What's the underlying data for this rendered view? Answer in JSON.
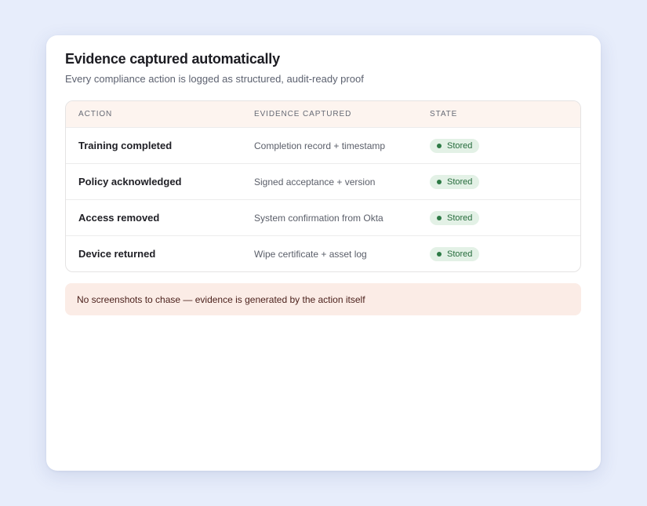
{
  "card": {
    "title": "Evidence captured automatically",
    "subtitle": "Every compliance action is logged as structured, audit-ready proof"
  },
  "table": {
    "headers": {
      "action": "ACTION",
      "evidence": "EVIDENCE CAPTURED",
      "state": "STATE"
    },
    "rows": [
      {
        "action": "Training completed",
        "evidence": "Completion record + timestamp",
        "state": "Stored"
      },
      {
        "action": "Policy acknowledged",
        "evidence": "Signed acceptance + version",
        "state": "Stored"
      },
      {
        "action": "Access removed",
        "evidence": "System confirmation from Okta",
        "state": "Stored"
      },
      {
        "action": "Device returned",
        "evidence": "Wipe certificate + asset log",
        "state": "Stored"
      }
    ]
  },
  "note": {
    "text": "No screenshots to chase — evidence is generated by the action itself"
  },
  "colors": {
    "page_background": "#e7edfb",
    "header_background": "#fdf4ef",
    "note_background": "#fbece6",
    "badge_background": "#e3f1e6",
    "badge_text": "#256b3b"
  },
  "icons": {
    "status_dot": "status-dot-icon"
  }
}
